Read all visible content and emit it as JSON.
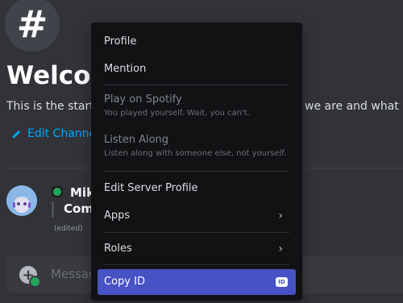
{
  "channel": {
    "hash_glyph": "#",
    "welcome_title": "Welcom",
    "desc_left": "This is the start",
    "desc_right": "we are and what w",
    "edit_channel_label": "Edit Channe"
  },
  "message": {
    "username": "Mik",
    "text": "Comi",
    "edited": "(edited)"
  },
  "composer": {
    "placeholder": "Message",
    "add_glyph": "+"
  },
  "context_menu": {
    "profile": "Profile",
    "mention": "Mention",
    "play_on_spotify": "Play on Spotify",
    "play_on_spotify_sub": "You played yourself. Wait, you can't.",
    "listen_along": "Listen Along",
    "listen_along_sub": "Listen along with someone else, not yourself.",
    "edit_server_profile": "Edit Server Profile",
    "apps": "Apps",
    "roles": "Roles",
    "copy_id": "Copy ID",
    "id_badge": "ID"
  },
  "icons": {
    "chevron": "›"
  },
  "colors": {
    "background": "#313338",
    "menu_background": "#111214",
    "accent": "#4752c4",
    "link": "#00a8fc",
    "online": "#23a55a"
  }
}
